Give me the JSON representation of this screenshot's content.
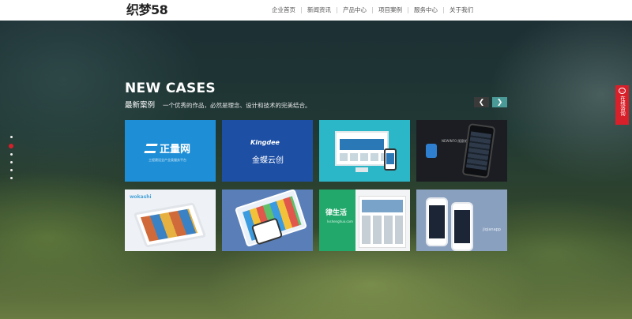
{
  "header": {
    "logo": "织梦58",
    "nav": [
      "企业首页",
      "新闻资讯",
      "产品中心",
      "项目案例",
      "服务中心",
      "关于我们"
    ]
  },
  "section": {
    "title": "NEW CASES",
    "subtitle_cn": "最新案例",
    "description": "一个优秀的作品，必然是理念、设计和技术的完美结合。",
    "prev_icon": "chevron-left-icon",
    "next_icon": "chevron-right-icon"
  },
  "cases": [
    {
      "logo": "正量网",
      "tagline": "工程建设全产业类服务平台"
    },
    {
      "logo": "Kingdee",
      "name": "金蝶云创"
    },
    {},
    {
      "text": "NEWINFO 随意前思"
    },
    {
      "logo": "wokashi"
    },
    {},
    {
      "logo": "律生活",
      "url": "lvshenghuo.com"
    },
    {
      "text": "jiqianapp"
    }
  ],
  "float_panel": {
    "label": "在线咨询",
    "icon": "chat-bubble-icon"
  },
  "pager": {
    "count": 6,
    "active_index": 1
  },
  "colors": {
    "accent_red": "#d7202a",
    "next_button": "#4a9a98",
    "prev_button": "#3a3a3a"
  }
}
